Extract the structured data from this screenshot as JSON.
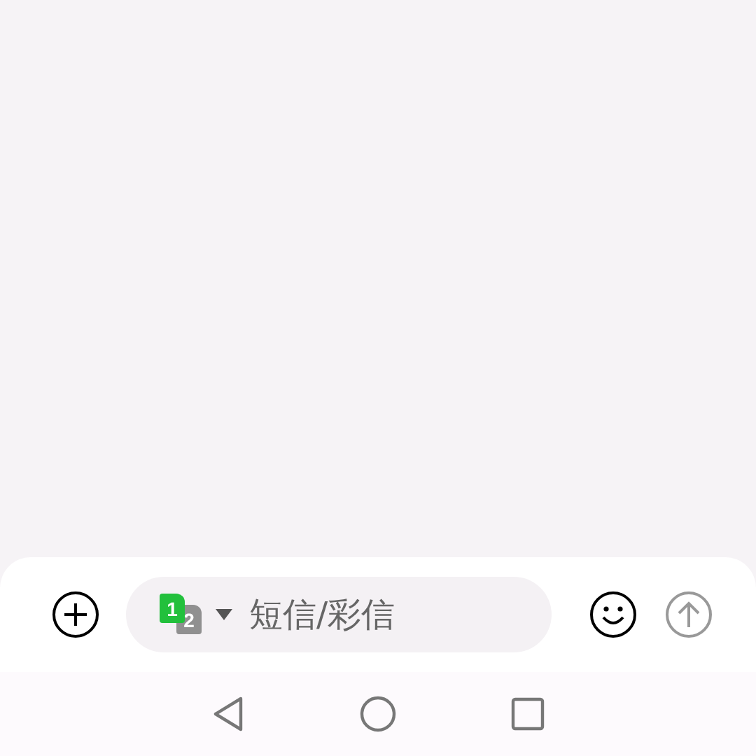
{
  "composer": {
    "sim_selector": {
      "primary": "1",
      "secondary": "2"
    },
    "message": {
      "placeholder": "短信/彩信"
    },
    "send": {
      "disabled": true
    }
  }
}
